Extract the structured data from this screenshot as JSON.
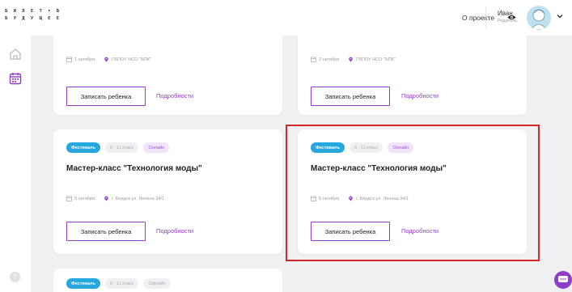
{
  "header": {
    "logo_line1": "Б И Л Е Т • В",
    "logo_line2": "Б У Д У Щ Е Е",
    "about_link": "О проекте",
    "user_name": "Иван",
    "user_role": "Родитель"
  },
  "icons": {
    "home": "home-icon",
    "calendar": "calendar-icon",
    "help": "help-icon",
    "eye": "eye-icon",
    "chevron": "chevron-down-icon",
    "chat": "chat-icon"
  },
  "colors": {
    "accent": "#8f3cc9",
    "festival_tag": "#26a7dd",
    "highlight": "#d32828"
  },
  "cards_top": [
    {
      "date": "1 октября",
      "place": "ГБПОУ НСО \"БПК\"",
      "enroll": "Записать ребенка",
      "details": "Подробности"
    },
    {
      "date": "2 октября",
      "place": "ГБПОУ НСО \"БПК\"",
      "enroll": "Записать ребенка",
      "details": "Подробности"
    }
  ],
  "cards_mid": [
    {
      "tag_type": "Фестиваль",
      "tag_grade": "6 - 11 класс",
      "tag_format": "Онлайн",
      "title": "Мастер-класс \"Технология моды\"",
      "date": "5 октября",
      "place": "г. Бердск ул. Ленина 34/1",
      "enroll": "Записать ребенка",
      "details": "Подробности"
    },
    {
      "tag_type": "Фестиваль",
      "tag_grade": "6 - 11 класс",
      "tag_format": "Онлайн",
      "title": "Мастер-класс \"Технология моды\"",
      "date": "5 октября",
      "place": "г. Бердск ул. Ленина 34/1",
      "enroll": "Записать ребенка",
      "details": "Подробности"
    }
  ],
  "card_bottom": {
    "tag_type": "Фестиваль",
    "tag_grade": "6 - 11 класс",
    "tag_format": "Офлайн"
  },
  "help_label": "?"
}
